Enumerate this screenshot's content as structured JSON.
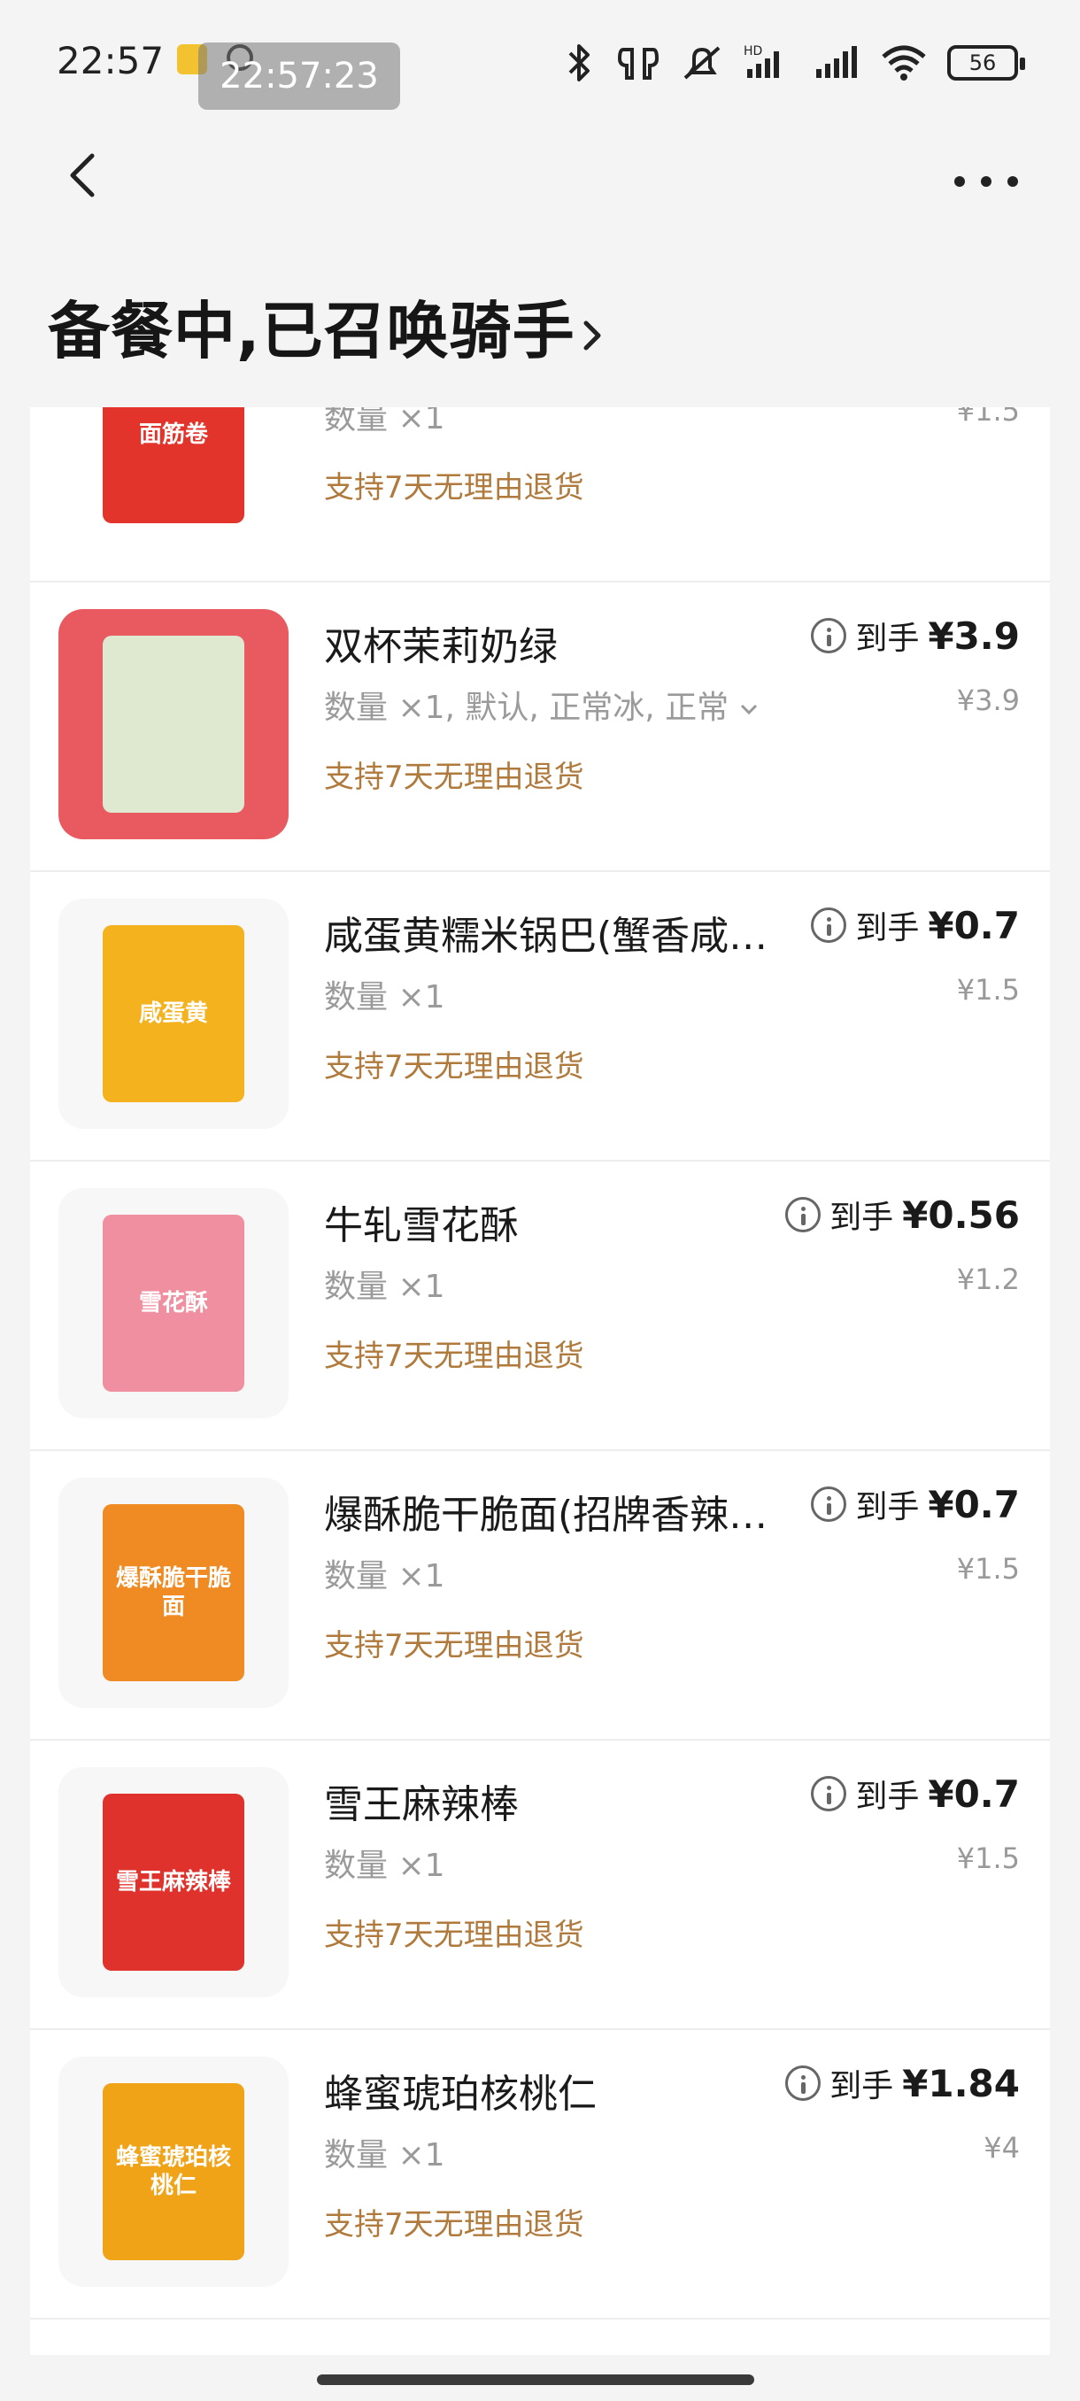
{
  "status_bar": {
    "time": "22:57",
    "overlay_time": "22:57:23",
    "battery": "56"
  },
  "header": {
    "title": "备餐中,已召唤骑手"
  },
  "items": [
    {
      "name": "",
      "spec": "数量 ×1",
      "return_policy": "支持7天无理由退货",
      "final_label": "",
      "final_price": "",
      "original_price": "¥1.5",
      "thumb_text": "面筋卷",
      "thumb_bg": "#ffffff",
      "thumb_accent": "#e2342a"
    },
    {
      "name": "双杯茉莉奶绿",
      "spec": "数量 ×1, 默认, 正常冰, 正常",
      "return_policy": "支持7天无理由退货",
      "final_label": "到手",
      "final_price": "¥3.9",
      "original_price": "¥3.9",
      "thumb_text": "",
      "thumb_bg": "#e85a5f",
      "thumb_accent": "#dfe9cf"
    },
    {
      "name": "咸蛋黄糯米锅巴(蟹香咸…",
      "spec": "数量 ×1",
      "return_policy": "支持7天无理由退货",
      "final_label": "到手",
      "final_price": "¥0.7",
      "original_price": "¥1.5",
      "thumb_text": "咸蛋黄",
      "thumb_bg": "#f7f7f7",
      "thumb_accent": "#f4b21e"
    },
    {
      "name": "牛轧雪花酥",
      "spec": "数量 ×1",
      "return_policy": "支持7天无理由退货",
      "final_label": "到手",
      "final_price": "¥0.56",
      "original_price": "¥1.2",
      "thumb_text": "雪花酥",
      "thumb_bg": "#f7f7f7",
      "thumb_accent": "#f08fa0"
    },
    {
      "name": "爆酥脆干脆面(招牌香辣…",
      "spec": "数量 ×1",
      "return_policy": "支持7天无理由退货",
      "final_label": "到手",
      "final_price": "¥0.7",
      "original_price": "¥1.5",
      "thumb_text": "爆酥脆干脆面",
      "thumb_bg": "#f7f7f7",
      "thumb_accent": "#f08a22"
    },
    {
      "name": "雪王麻辣棒",
      "spec": "数量 ×1",
      "return_policy": "支持7天无理由退货",
      "final_label": "到手",
      "final_price": "¥0.7",
      "original_price": "¥1.5",
      "thumb_text": "雪王麻辣棒",
      "thumb_bg": "#f7f7f7",
      "thumb_accent": "#e0322c"
    },
    {
      "name": "蜂蜜琥珀核桃仁",
      "spec": "数量 ×1",
      "return_policy": "支持7天无理由退货",
      "final_label": "到手",
      "final_price": "¥1.84",
      "original_price": "¥4",
      "thumb_text": "蜂蜜琥珀核桃仁",
      "thumb_bg": "#f7f7f7",
      "thumb_accent": "#f1a318"
    }
  ]
}
